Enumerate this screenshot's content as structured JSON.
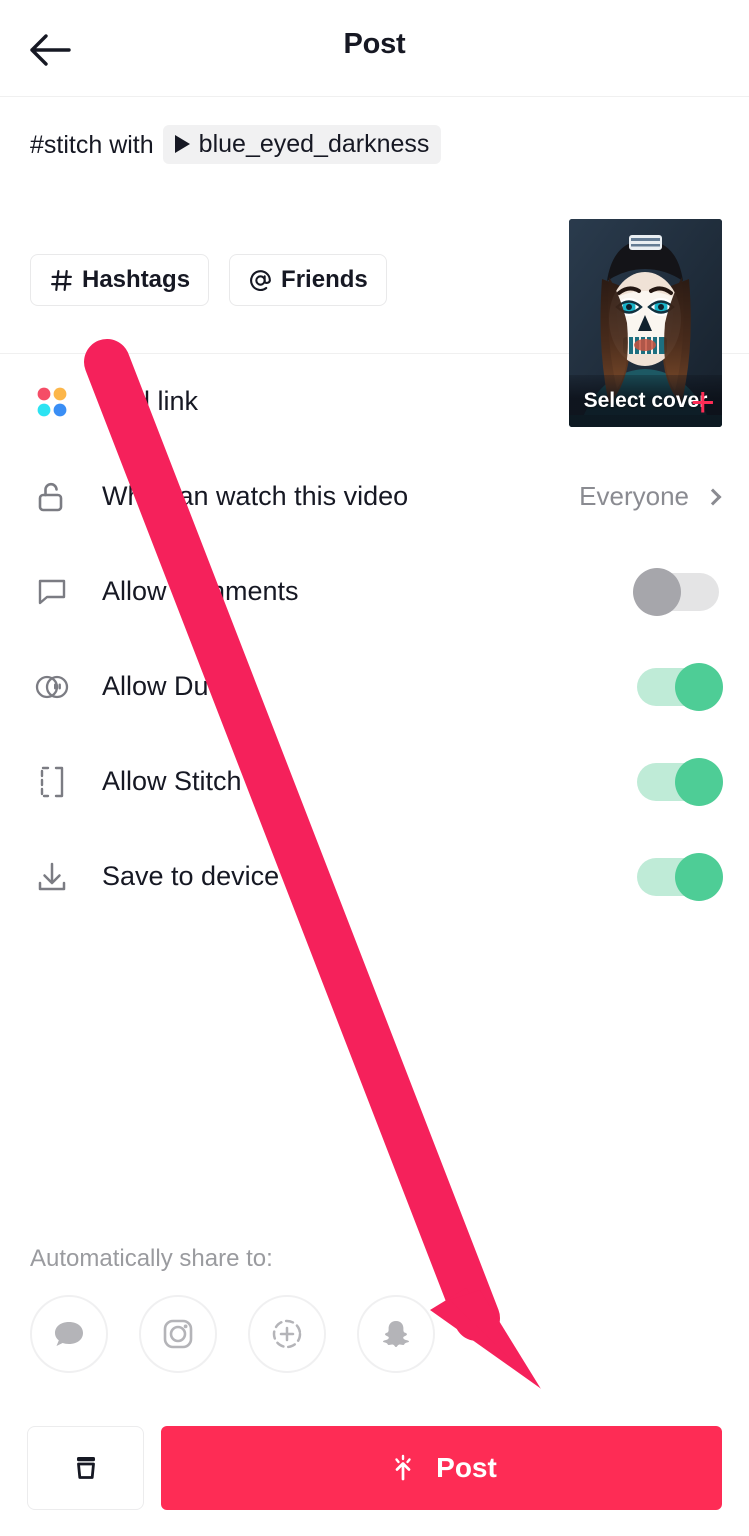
{
  "header": {
    "title": "Post",
    "back_icon": "arrow-left-icon"
  },
  "caption": {
    "stitch_prefix": "#stitch with",
    "mention_username": "blue_eyed_darkness",
    "mention_play_icon": "play-triangle-icon",
    "hashtags_button": "Hashtags",
    "hashtags_icon": "hash-icon",
    "friends_button": "Friends",
    "friends_icon": "at-icon",
    "cover": {
      "label": "Select cover",
      "alt": "skull-face-paint-thumbnail"
    }
  },
  "settings": [
    {
      "label": "Add link",
      "icon": "four-dots-icon",
      "control": "plus",
      "plus_label": "+",
      "name": "add-link"
    },
    {
      "label": "Who can watch this video",
      "icon": "unlock-icon",
      "control": "value",
      "value": "Everyone",
      "name": "who-can-watch"
    },
    {
      "label": "Allow comments",
      "icon": "comment-icon",
      "control": "toggle",
      "state": "off",
      "name": "allow-comments"
    },
    {
      "label": "Allow Duet",
      "icon": "duet-icon",
      "control": "toggle",
      "state": "on",
      "name": "allow-duet"
    },
    {
      "label": "Allow Stitch",
      "icon": "stitch-icon",
      "control": "toggle",
      "state": "on",
      "name": "allow-stitch"
    },
    {
      "label": "Save to device",
      "icon": "download-icon",
      "control": "toggle",
      "state": "on",
      "name": "save-to-device"
    }
  ],
  "share": {
    "title": "Automatically share to:",
    "targets": [
      {
        "icon": "message-bubble-icon",
        "name": "share-messages"
      },
      {
        "icon": "instagram-icon",
        "name": "share-instagram"
      },
      {
        "icon": "instagram-story-icon",
        "name": "share-instagram-story"
      },
      {
        "icon": "snapchat-icon",
        "name": "share-snapchat"
      }
    ]
  },
  "bottom": {
    "drafts_icon": "archive-box-icon",
    "post_label": "Post",
    "post_icon": "upload-sparkle-icon"
  },
  "colors": {
    "brand_red": "#fe2c55",
    "annotation_red": "#f5215b",
    "toggle_on_knob": "#4ecd96",
    "toggle_on_track": "#bfebd7",
    "toggle_off_knob": "#a6a6ab",
    "toggle_off_track": "#e4e4e5",
    "text_primary": "#161823",
    "text_muted": "#8a8b91"
  }
}
